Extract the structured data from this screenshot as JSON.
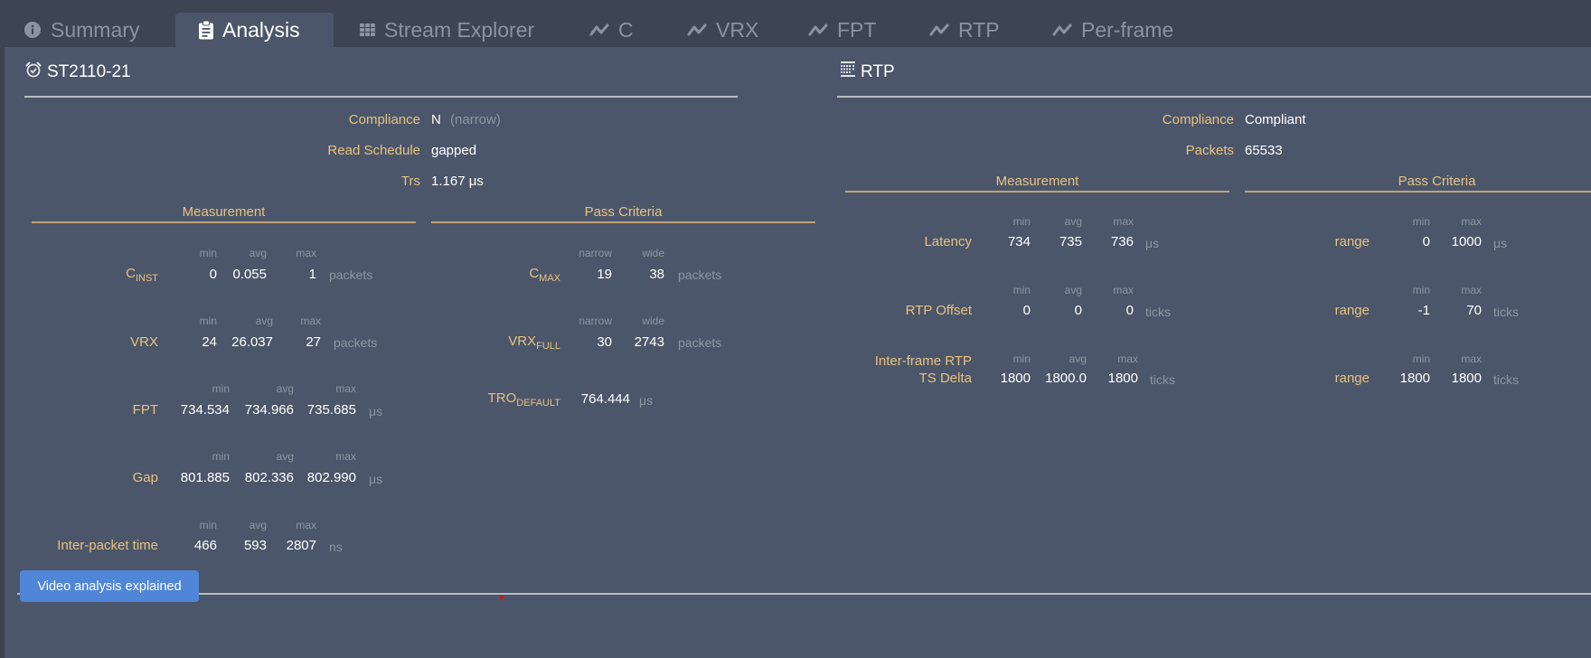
{
  "tabs": [
    {
      "label": "Summary",
      "icon": "info-circle-icon",
      "active": false
    },
    {
      "label": "Analysis",
      "icon": "clipboard-icon",
      "active": true
    },
    {
      "label": "Stream Explorer",
      "icon": "grid-icon",
      "active": false
    },
    {
      "label": "C",
      "icon": "line-chart-icon",
      "active": false
    },
    {
      "label": "VRX",
      "icon": "line-chart-icon",
      "active": false
    },
    {
      "label": "FPT",
      "icon": "line-chart-icon",
      "active": false
    },
    {
      "label": "RTP",
      "icon": "line-chart-icon",
      "active": false
    },
    {
      "label": "Per-frame",
      "icon": "line-chart-icon",
      "active": false
    }
  ],
  "st2110": {
    "title": "ST2110-21",
    "icon": "alarm-clock-icon",
    "compliance_label": "Compliance",
    "compliance_value": "N",
    "compliance_note": "(narrow)",
    "read_schedule_label": "Read Schedule",
    "read_schedule_value": "gapped",
    "trs_label": "Trs",
    "trs_value": "1.167 μs",
    "measurement_header": "Measurement",
    "pass_criteria_header": "Pass Criteria",
    "measurements": [
      {
        "name": "C",
        "sub": "INST",
        "min": "0",
        "avg": "0.055",
        "max": "1",
        "unit": "packets"
      },
      {
        "name": "VRX",
        "sub": "",
        "min": "24",
        "avg": "26.037",
        "max": "27",
        "unit": "packets"
      },
      {
        "name": "FPT",
        "sub": "",
        "min": "734.534",
        "avg": "734.966",
        "max": "735.685",
        "unit": "μs"
      },
      {
        "name": "Gap",
        "sub": "",
        "min": "801.885",
        "avg": "802.336",
        "max": "802.990",
        "unit": "μs"
      },
      {
        "name": "Inter-packet time",
        "sub": "",
        "min": "466",
        "avg": "593",
        "max": "2807",
        "unit": "ns"
      }
    ],
    "col_headers": {
      "min": "min",
      "avg": "avg",
      "max": "max",
      "narrow": "narrow",
      "wide": "wide"
    },
    "criteria": [
      {
        "name": "C",
        "sub": "MAX",
        "narrow": "19",
        "wide": "38",
        "unit": "packets"
      },
      {
        "name": "VRX",
        "sub": "FULL",
        "narrow": "30",
        "wide": "2743",
        "unit": "packets"
      },
      {
        "name": "TRO",
        "sub": "DEFAULT",
        "value": "764.444",
        "unit": "μs"
      }
    ]
  },
  "rtp": {
    "title": "RTP",
    "icon": "table-icon",
    "compliance_label": "Compliance",
    "compliance_value": "Compliant",
    "packets_label": "Packets",
    "packets_value": "65533",
    "measurement_header": "Measurement",
    "pass_criteria_header": "Pass Criteria",
    "measurements": [
      {
        "name": "Latency",
        "name2": "",
        "min": "734",
        "avg": "735",
        "max": "736",
        "unit": "μs"
      },
      {
        "name": "RTP Offset",
        "name2": "",
        "min": "0",
        "avg": "0",
        "max": "0",
        "unit": "ticks"
      },
      {
        "name": "Inter-frame RTP",
        "name2": "TS Delta",
        "min": "1800",
        "avg": "1800.0",
        "max": "1800",
        "unit": "ticks"
      }
    ],
    "criteria": [
      {
        "name": "range",
        "min": "0",
        "max": "1000",
        "unit": "μs"
      },
      {
        "name": "range",
        "min": "-1",
        "max": "70",
        "unit": "ticks"
      },
      {
        "name": "range",
        "min": "1800",
        "max": "1800",
        "unit": "ticks"
      }
    ]
  },
  "footer": {
    "button_label": "Video analysis explained"
  }
}
